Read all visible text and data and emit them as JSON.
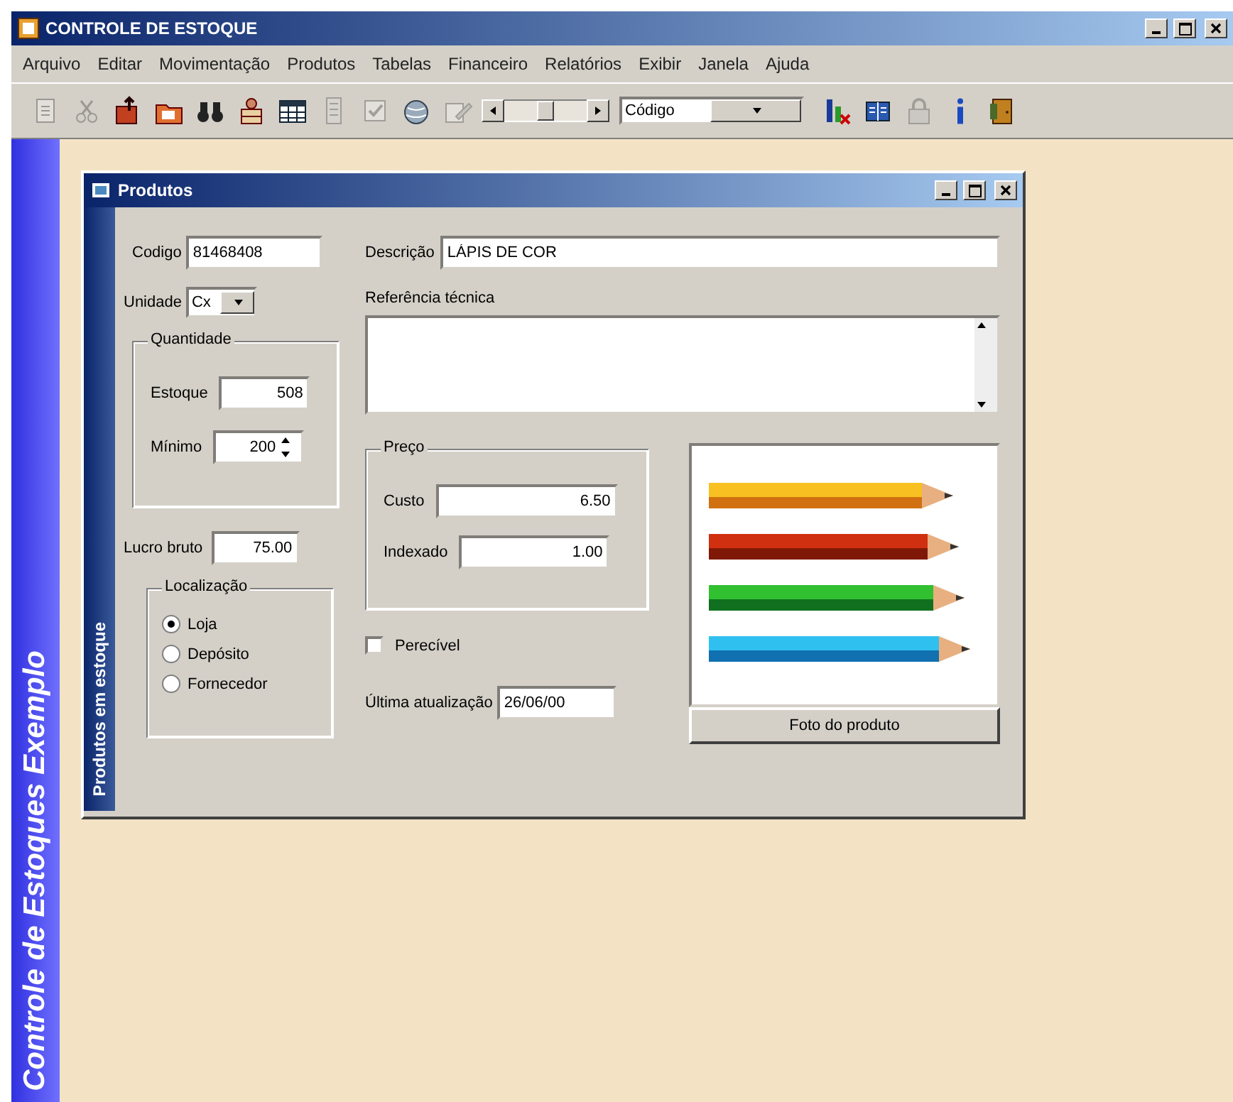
{
  "window": {
    "title": "CONTROLE DE ESTOQUE"
  },
  "menu": [
    {
      "label": "Arquivo"
    },
    {
      "label": "Editar"
    },
    {
      "label": "Movimentação"
    },
    {
      "label": "Produtos"
    },
    {
      "label": "Tabelas"
    },
    {
      "label": "Financeiro"
    },
    {
      "label": "Relatórios"
    },
    {
      "label": "Exibir"
    },
    {
      "label": "Janela"
    },
    {
      "label": "Ajuda"
    }
  ],
  "toolbar": [
    {
      "kind": "page",
      "disabled": true
    },
    {
      "kind": "scissors",
      "disabled": true
    },
    {
      "kind": "export",
      "disabled": false
    },
    {
      "kind": "folder",
      "disabled": false
    },
    {
      "kind": "binoculars",
      "disabled": false
    },
    {
      "kind": "people",
      "disabled": false
    },
    {
      "kind": "grid",
      "disabled": false
    },
    {
      "kind": "list",
      "disabled": true
    },
    {
      "kind": "check",
      "disabled": true
    },
    {
      "kind": "globe",
      "disabled": false
    },
    {
      "kind": "edit",
      "disabled": true
    },
    {
      "kind": "navigator",
      "disabled": false
    },
    {
      "kind": "combo",
      "disabled": false,
      "value": "Código"
    },
    {
      "kind": "chart",
      "disabled": false
    },
    {
      "kind": "book",
      "disabled": false
    },
    {
      "kind": "lock",
      "disabled": true
    },
    {
      "kind": "info",
      "disabled": false
    },
    {
      "kind": "door",
      "disabled": false
    }
  ],
  "side_banner": "Controle de Estoques Exemplo",
  "child_window": {
    "title": "Produtos",
    "side_label": "Produtos em estoque",
    "codigo": {
      "label": "Codigo",
      "value": "81468408"
    },
    "descricao": {
      "label": "Descrição",
      "value": "LÁPIS DE COR"
    },
    "unidade": {
      "label": "Unidade",
      "value": "Cx"
    },
    "referencia": {
      "label": "Referência técnica"
    },
    "quantidade": {
      "title": "Quantidade",
      "estoque": {
        "label": "Estoque",
        "value": "508"
      },
      "minimo": {
        "label": "Mínimo",
        "value": "200"
      }
    },
    "lucro": {
      "label": "Lucro bruto",
      "value": "75.00"
    },
    "localizacao": {
      "title": "Localização",
      "options": [
        {
          "label": "Loja",
          "selected": true
        },
        {
          "label": "Depósito",
          "selected": false
        },
        {
          "label": "Fornecedor",
          "selected": false
        }
      ]
    },
    "preco": {
      "title": "Preço",
      "custo": {
        "label": "Custo",
        "value": "6.50"
      },
      "indexado": {
        "label": "Indexado",
        "value": "1.00"
      }
    },
    "perecivel": {
      "label": "Perecível",
      "checked": false
    },
    "ultima": {
      "label": "Última atualização",
      "value": "26/06/00"
    },
    "photo_button": "Foto do produto"
  }
}
